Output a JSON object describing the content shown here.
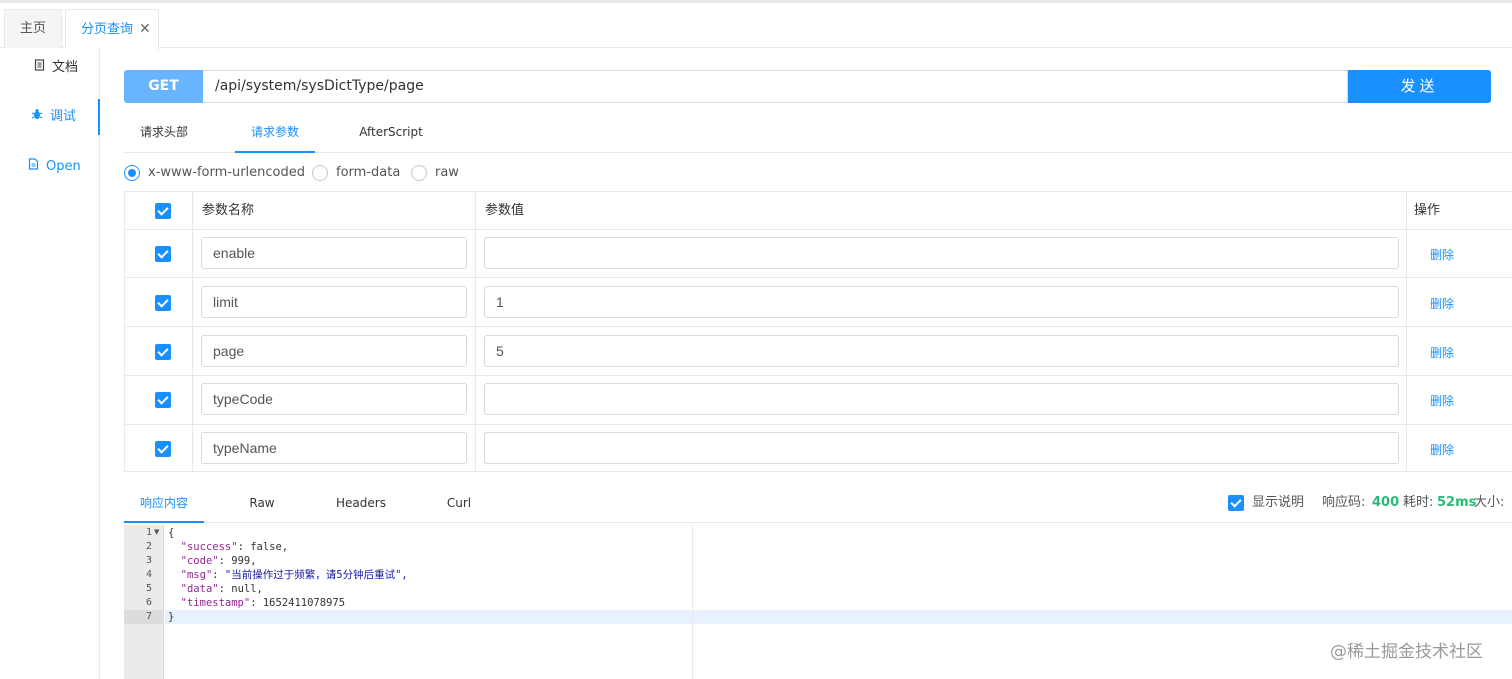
{
  "tabs": {
    "home": "主页",
    "active": "分页查询",
    "close": "✕"
  },
  "sidebar": {
    "items": [
      {
        "label": "文档",
        "icon": "document-icon"
      },
      {
        "label": "调试",
        "icon": "bug-icon"
      },
      {
        "label": "Open",
        "icon": "file-icon"
      }
    ]
  },
  "request": {
    "method": "GET",
    "url": "/api/system/sysDictType/page",
    "send_label": "发送"
  },
  "request_tabs": [
    "请求头部",
    "请求参数",
    "AfterScript"
  ],
  "body_types": [
    "x-www-form-urlencoded",
    "form-data",
    "raw"
  ],
  "params": {
    "headers": {
      "name": "参数名称",
      "value": "参数值",
      "action": "操作"
    },
    "rows": [
      {
        "name": "enable",
        "value": "",
        "action": "删除"
      },
      {
        "name": "limit",
        "value": "1",
        "action": "删除"
      },
      {
        "name": "page",
        "value": "5",
        "action": "删除"
      },
      {
        "name": "typeCode",
        "value": "",
        "action": "删除"
      },
      {
        "name": "typeName",
        "value": "",
        "action": "删除"
      }
    ]
  },
  "response_tabs": [
    "响应内容",
    "Raw",
    "Headers",
    "Curl"
  ],
  "response_meta": {
    "show_desc": "显示说明",
    "code_label": "响应码:",
    "code_value": "400",
    "time_label": "耗时:",
    "time_value": "52ms",
    "size_label": "大小:"
  },
  "response_body": {
    "line_numbers": [
      "1",
      "2",
      "3",
      "4",
      "5",
      "6",
      "7"
    ],
    "open_brace": "{",
    "close_brace": "}",
    "fields": [
      {
        "key": "\"success\"",
        "value": "false,"
      },
      {
        "key": "\"code\"",
        "value": "999,"
      },
      {
        "key": "\"msg\"",
        "value": "\"当前操作过于频繁，请5分钟后重试\","
      },
      {
        "key": "\"data\"",
        "value": "null,"
      },
      {
        "key": "\"timestamp\"",
        "value": "1652411078975"
      }
    ]
  },
  "watermark": "@稀土掘金技术社区",
  "colors": {
    "accent": "#1890ff",
    "method_bg": "#69b4ff",
    "status_green": "#2eb875"
  }
}
